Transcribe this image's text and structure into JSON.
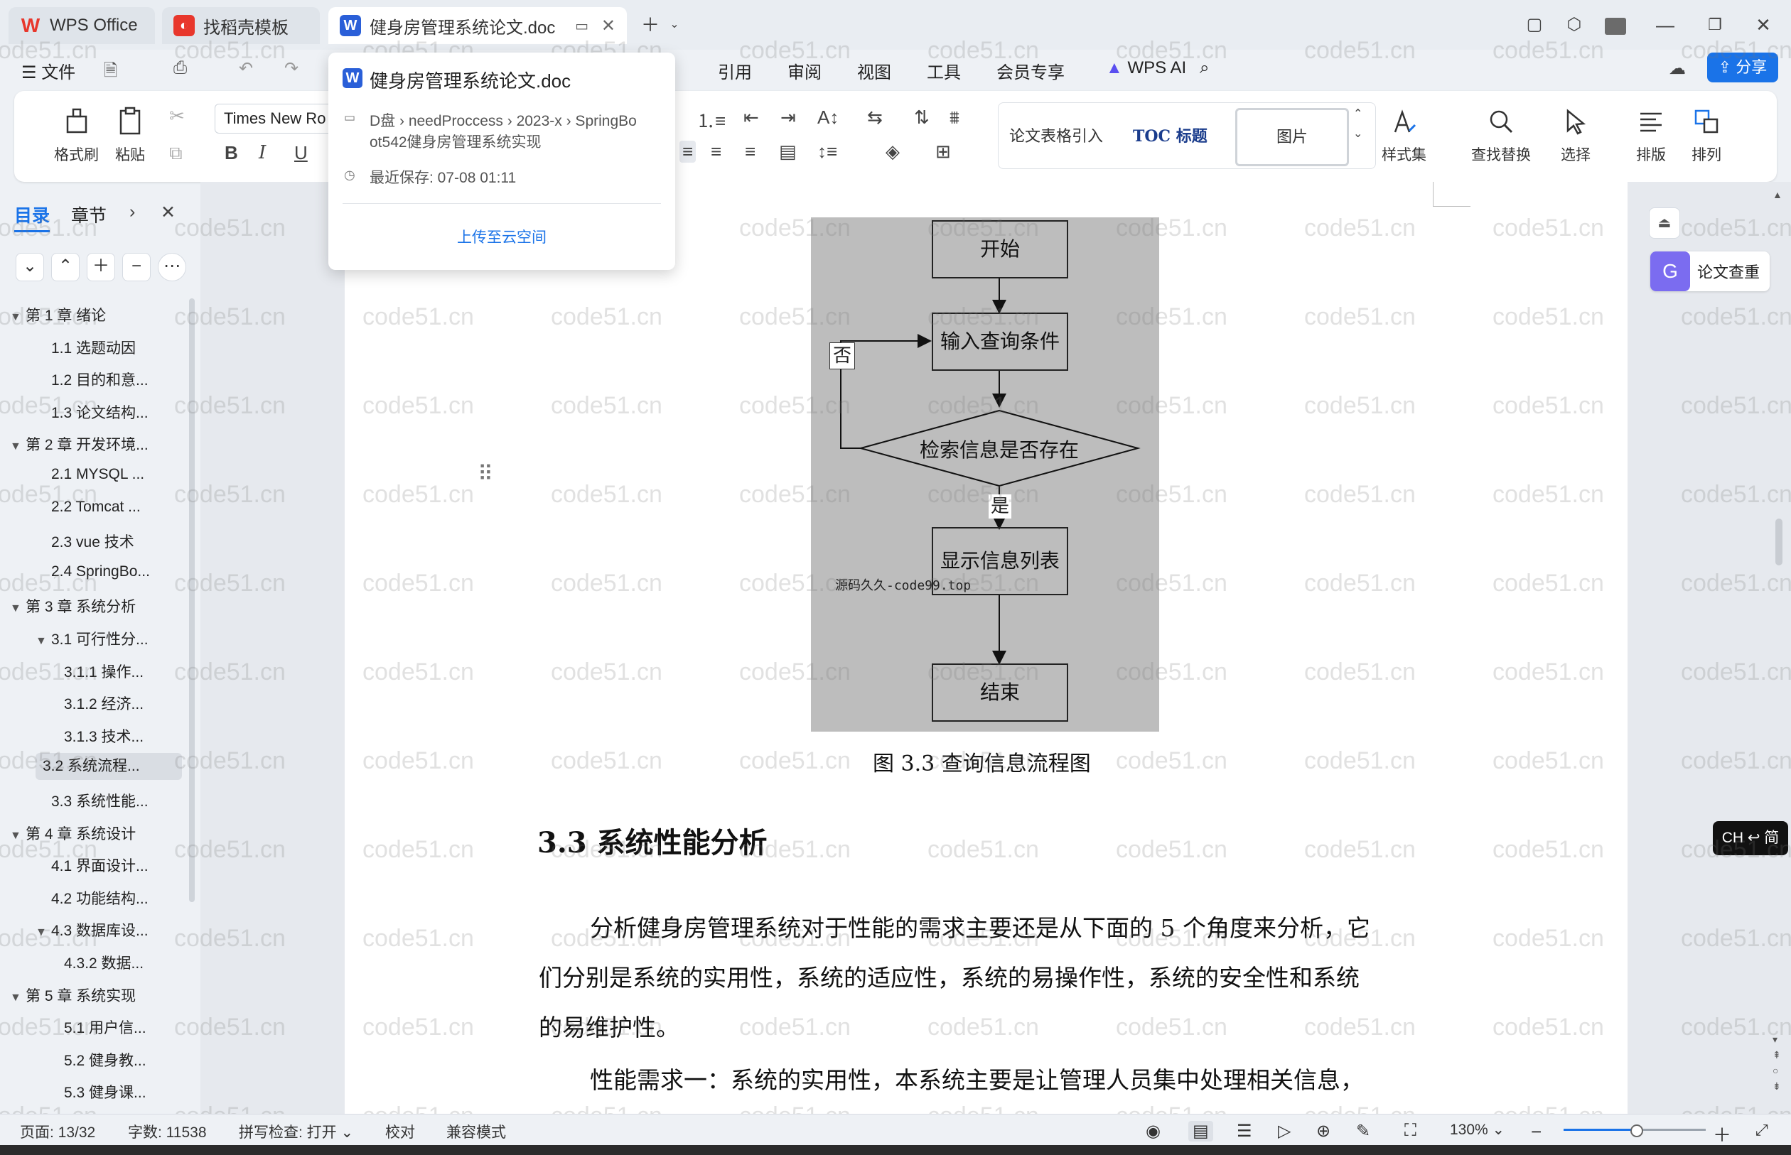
{
  "tabs": [
    {
      "label": "WPS Office",
      "icon": "wps-logo-icon"
    },
    {
      "label": "找稻壳模板",
      "icon": "docer-icon"
    },
    {
      "label": "健身房管理系统论文.doc",
      "icon": "word-doc-icon"
    }
  ],
  "menu": {
    "file": "文件",
    "items": [
      "引用",
      "审阅",
      "视图",
      "工具",
      "会员专享"
    ],
    "ai": "WPS AI",
    "share": "分享"
  },
  "ribbon": {
    "format_painter": "格式刷",
    "paste": "粘贴",
    "font": "Times New Ro",
    "styles": [
      "论文表格引入",
      "TOC 标题",
      "图片"
    ],
    "style_set": "样式集",
    "find_replace": "查找替换",
    "select": "选择",
    "layout": "排版",
    "arrange": "排列"
  },
  "nav": {
    "tab_toc": "目录",
    "tab_chapter": "章节",
    "items": [
      {
        "label": "第 1 章  绪论",
        "level": 1,
        "expanded": true
      },
      {
        "label": "1.1 选题动因",
        "level": 2
      },
      {
        "label": "1.2 目的和意...",
        "level": 2
      },
      {
        "label": "1.3 论文结构...",
        "level": 2
      },
      {
        "label": "第 2 章  开发环境...",
        "level": 1,
        "expanded": true
      },
      {
        "label": "2.1 MYSQL ...",
        "level": 2
      },
      {
        "label": "2.2 Tomcat ...",
        "level": 2
      },
      {
        "label": "2.3 vue 技术",
        "level": 2
      },
      {
        "label": "2.4 SpringBo...",
        "level": 2
      },
      {
        "label": "第 3 章  系统分析",
        "level": 1,
        "expanded": true
      },
      {
        "label": "3.1 可行性分...",
        "level": 2,
        "expanded": true
      },
      {
        "label": "3.1.1 操作...",
        "level": 3
      },
      {
        "label": "3.1.2 经济...",
        "level": 3
      },
      {
        "label": "3.1.3 技术...",
        "level": 3
      },
      {
        "label": "3.2 系统流程...",
        "level": 2,
        "selected": true
      },
      {
        "label": "3.3 系统性能...",
        "level": 2
      },
      {
        "label": "第 4 章  系统设计",
        "level": 1,
        "expanded": true
      },
      {
        "label": "4.1 界面设计...",
        "level": 2
      },
      {
        "label": "4.2 功能结构...",
        "level": 2
      },
      {
        "label": "4.3 数据库设...",
        "level": 2,
        "expanded": true
      },
      {
        "label": "4.3.2  数据...",
        "level": 3
      },
      {
        "label": "第 5 章  系统实现",
        "level": 1,
        "expanded": true
      },
      {
        "label": "5.1 用户信...",
        "level": 3
      },
      {
        "label": "5.2  健身教...",
        "level": 3
      },
      {
        "label": "5.3 健身课...",
        "level": 3
      }
    ]
  },
  "popup": {
    "title": "健身房管理系统论文.doc",
    "path_line1": "D盘 › needProccess › 2023-x › SpringBo",
    "path_line2": "ot542健身房管理系统实现",
    "saved": "最近保存: 07-08 01:11",
    "upload": "上传至云空间"
  },
  "document": {
    "flow": {
      "start": "开始",
      "input": "输入查询条件",
      "decision": "检索信息是否存在",
      "no": "否",
      "yes": "是",
      "show": "显示信息列表",
      "end": "结束",
      "watermark": "源码久久-code99.top"
    },
    "caption": "图 3.3  查询信息流程图",
    "heading": "3.3 系统性能分析",
    "para1_line1": "分析健身房管理系统对于性能的需求主要还是从下面的 5 个角度来分析，它",
    "para1_line2": "们分别是系统的实用性，系统的适应性，系统的易操作性，系统的安全性和系统",
    "para1_line3": "的易维护性。",
    "para2_line1": "性能需求一：系统的实用性，本系统主要是让管理人员集中处理相关信息，"
  },
  "right_panel": {
    "check": "论文查重",
    "ime": "CH ↩ 简"
  },
  "status": {
    "page": "页面: 13/32",
    "words": "字数: 11538",
    "spell": "拼写检查: 打开",
    "proof": "校对",
    "compat": "兼容模式",
    "zoom": "130%"
  },
  "watermark_text": "code51.cn",
  "colors": {
    "accent": "#1a73e8",
    "wps_red": "#e8372c",
    "word_blue": "#2a5fd8"
  }
}
